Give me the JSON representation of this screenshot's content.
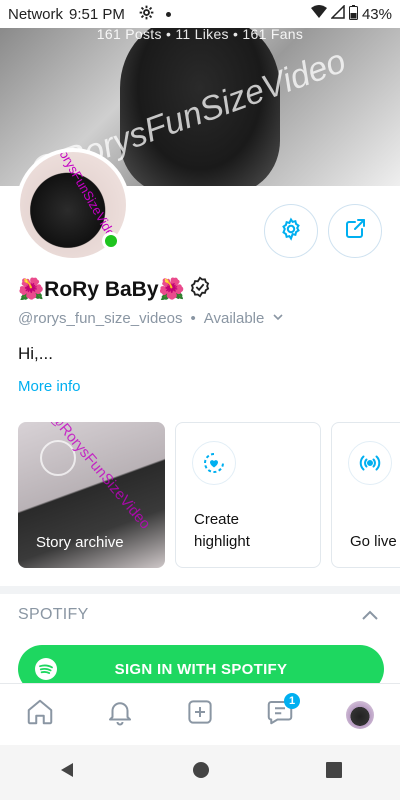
{
  "status_bar": {
    "carrier": "Network",
    "time": "9:51 PM",
    "battery": "43%",
    "icons": [
      "gear-icon",
      "dot-icon",
      "wifi-icon",
      "signal-icon",
      "battery-icon"
    ]
  },
  "cover": {
    "stats": "161 Posts   •   11 Likes   •   161 Fans",
    "watermark": "@RorysFunSizeVideo"
  },
  "profile": {
    "name": "🌺RoRy BaBy🌺",
    "username": "@rorys_fun_size_videos",
    "separator": "•",
    "availability": "Available",
    "bio": "Hi,...",
    "more_info": "More info",
    "avatar_watermark": "RorysFunSizeVideos"
  },
  "actions": {
    "settings_icon": "gear-icon",
    "share_icon": "share-icon"
  },
  "highlights": [
    {
      "label": "Story archive",
      "icon": "rewind-icon",
      "watermark": "@RorysFunSizeVideo"
    },
    {
      "label": "Create highlight",
      "icon": "heart-circle-icon"
    },
    {
      "label": "Go live",
      "icon": "broadcast-icon"
    }
  ],
  "spotify": {
    "section_title": "SPOTIFY",
    "button_label": "SIGN IN WITH SPOTIFY"
  },
  "bottom_nav": {
    "items": [
      "home-icon",
      "bell-icon",
      "plus-square-icon",
      "messages-icon",
      "profile-avatar"
    ],
    "messages_badge": "1"
  },
  "colors": {
    "accent": "#00aff0",
    "spotify_green": "#1ed760",
    "online": "#1ec41e"
  }
}
